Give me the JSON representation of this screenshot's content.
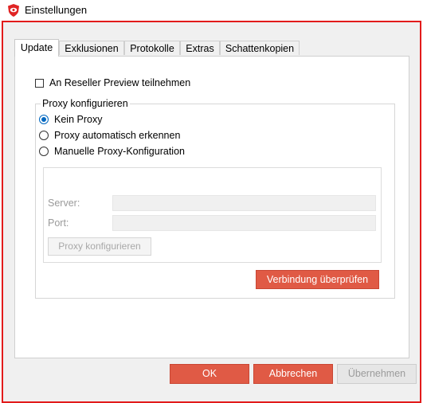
{
  "window": {
    "title": "Einstellungen"
  },
  "tabs": [
    {
      "label": "Update",
      "active": true
    },
    {
      "label": "Exklusionen",
      "active": false
    },
    {
      "label": "Protokolle",
      "active": false
    },
    {
      "label": "Extras",
      "active": false
    },
    {
      "label": "Schattenkopien",
      "active": false
    }
  ],
  "reseller": {
    "label": "An Reseller Preview teilnehmen",
    "checked": false
  },
  "proxy": {
    "group_title": "Proxy konfigurieren",
    "options": [
      {
        "label": "Kein Proxy",
        "selected": true
      },
      {
        "label": "Proxy automatisch erkennen",
        "selected": false
      },
      {
        "label": "Manuelle Proxy-Konfiguration",
        "selected": false
      }
    ],
    "server_label": "Server:",
    "server_value": "",
    "port_label": "Port:",
    "port_value": "",
    "configure_button": "Proxy konfigurieren",
    "test_button": "Verbindung überprüfen"
  },
  "footer": {
    "ok": "OK",
    "cancel": "Abbrechen",
    "apply": "Übernehmen"
  },
  "colors": {
    "accent_red": "#e05a45",
    "frame_red": "#e21b1b",
    "radio_blue": "#0067c0"
  },
  "icons": {
    "app": "shield-eye-icon"
  }
}
